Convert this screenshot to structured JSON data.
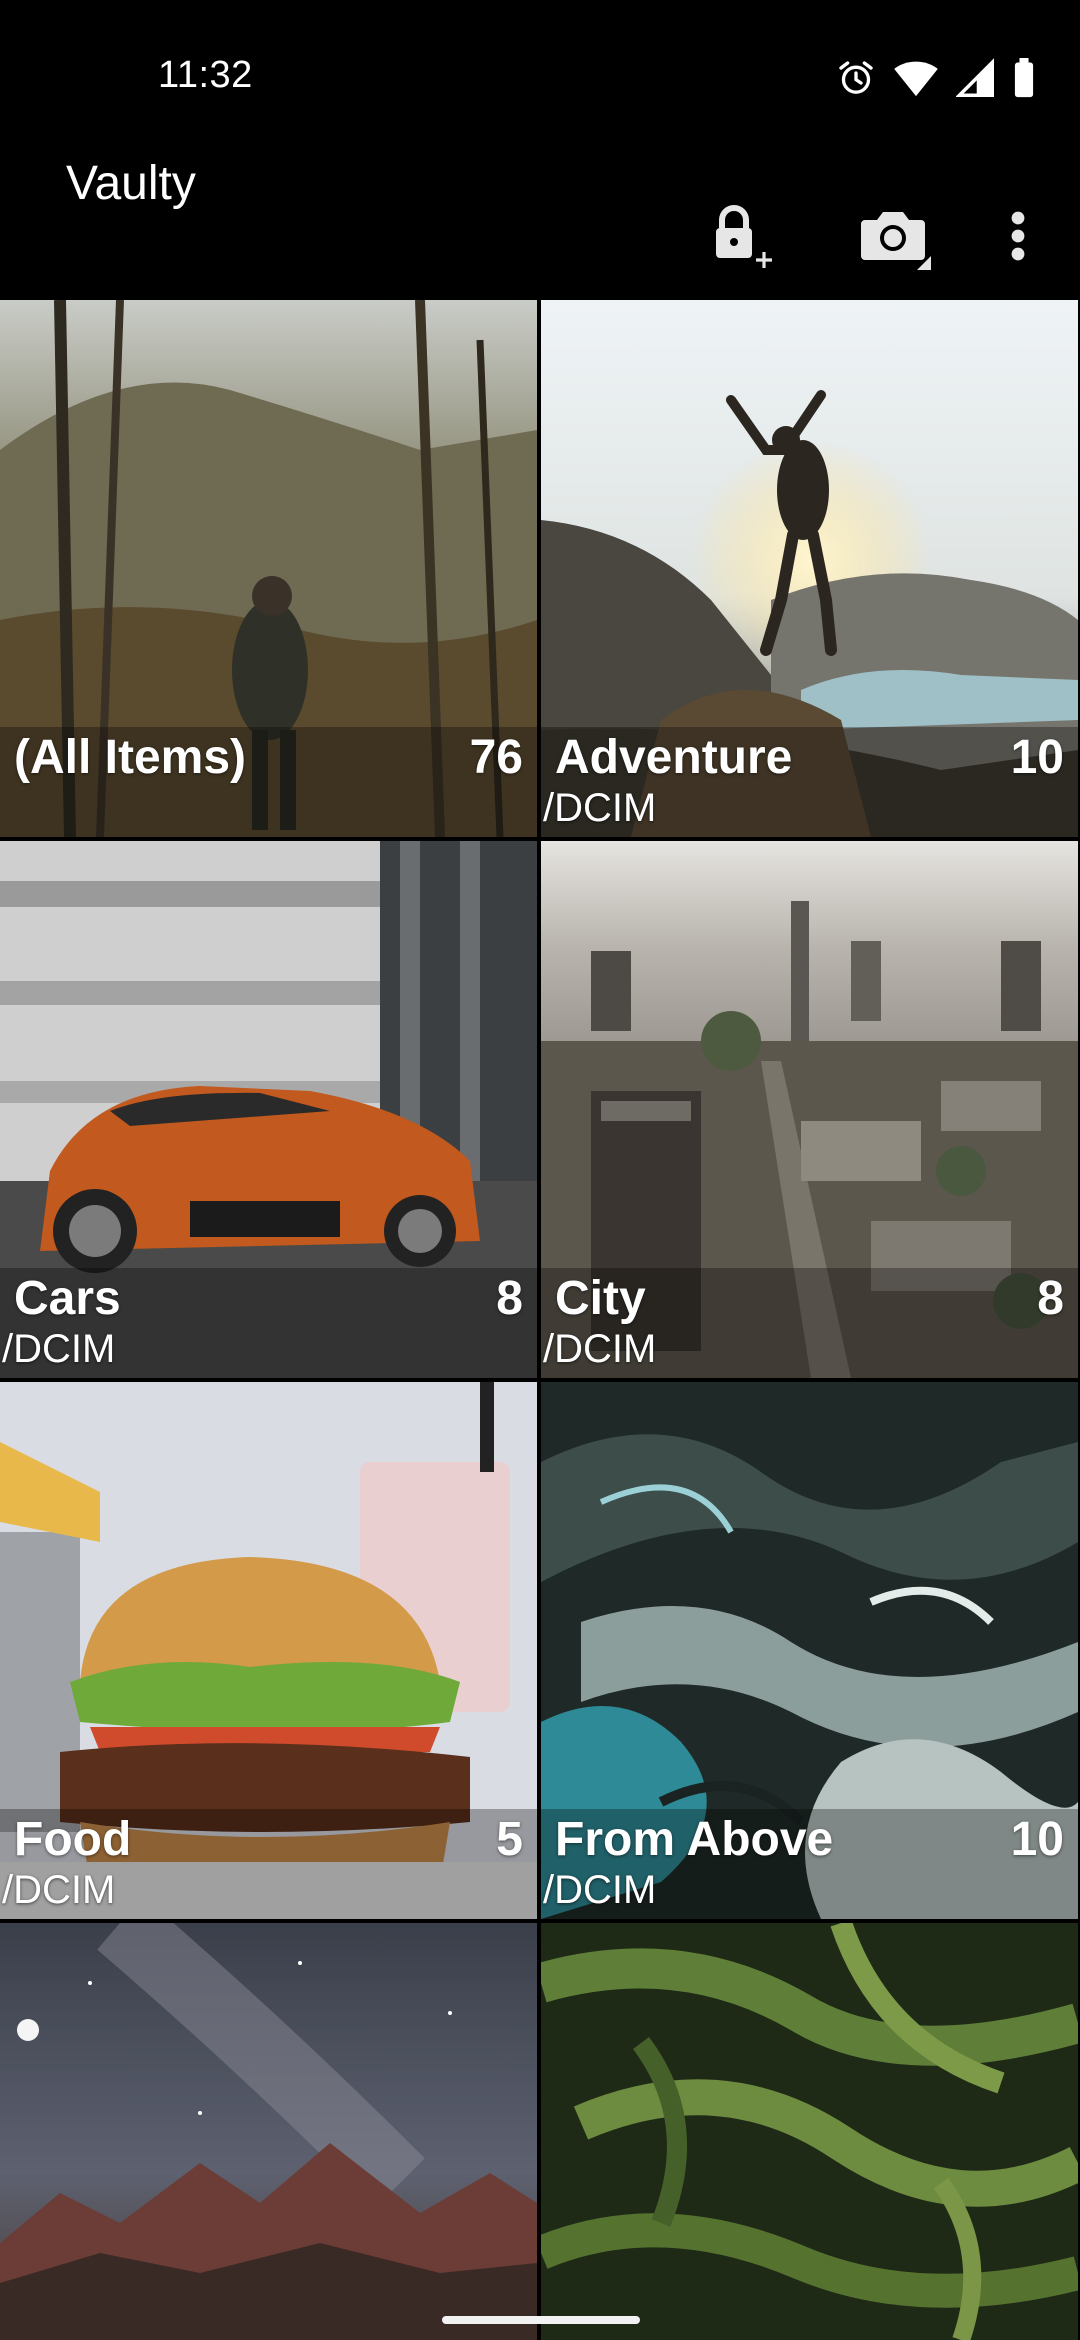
{
  "status_bar": {
    "time": "11:32",
    "icons": [
      "alarm-icon",
      "wifi-icon",
      "signal-icon",
      "battery-icon"
    ]
  },
  "app_bar": {
    "title": "Vaulty",
    "actions": [
      "lock-add-icon",
      "camera-icon",
      "more-vert-icon"
    ]
  },
  "albums": [
    {
      "name": "(All Items)",
      "count": "76",
      "path": ""
    },
    {
      "name": "Adventure",
      "count": "10",
      "path": "/DCIM"
    },
    {
      "name": "Cars",
      "count": "8",
      "path": "/DCIM"
    },
    {
      "name": "City",
      "count": "8",
      "path": "/DCIM"
    },
    {
      "name": "Food",
      "count": "5",
      "path": "/DCIM"
    },
    {
      "name": "From Above",
      "count": "10",
      "path": "/DCIM"
    },
    {
      "name": "",
      "count": "",
      "path": ""
    },
    {
      "name": "",
      "count": "",
      "path": ""
    }
  ],
  "colors": {
    "background": "#000000",
    "text": "#ffffff"
  }
}
